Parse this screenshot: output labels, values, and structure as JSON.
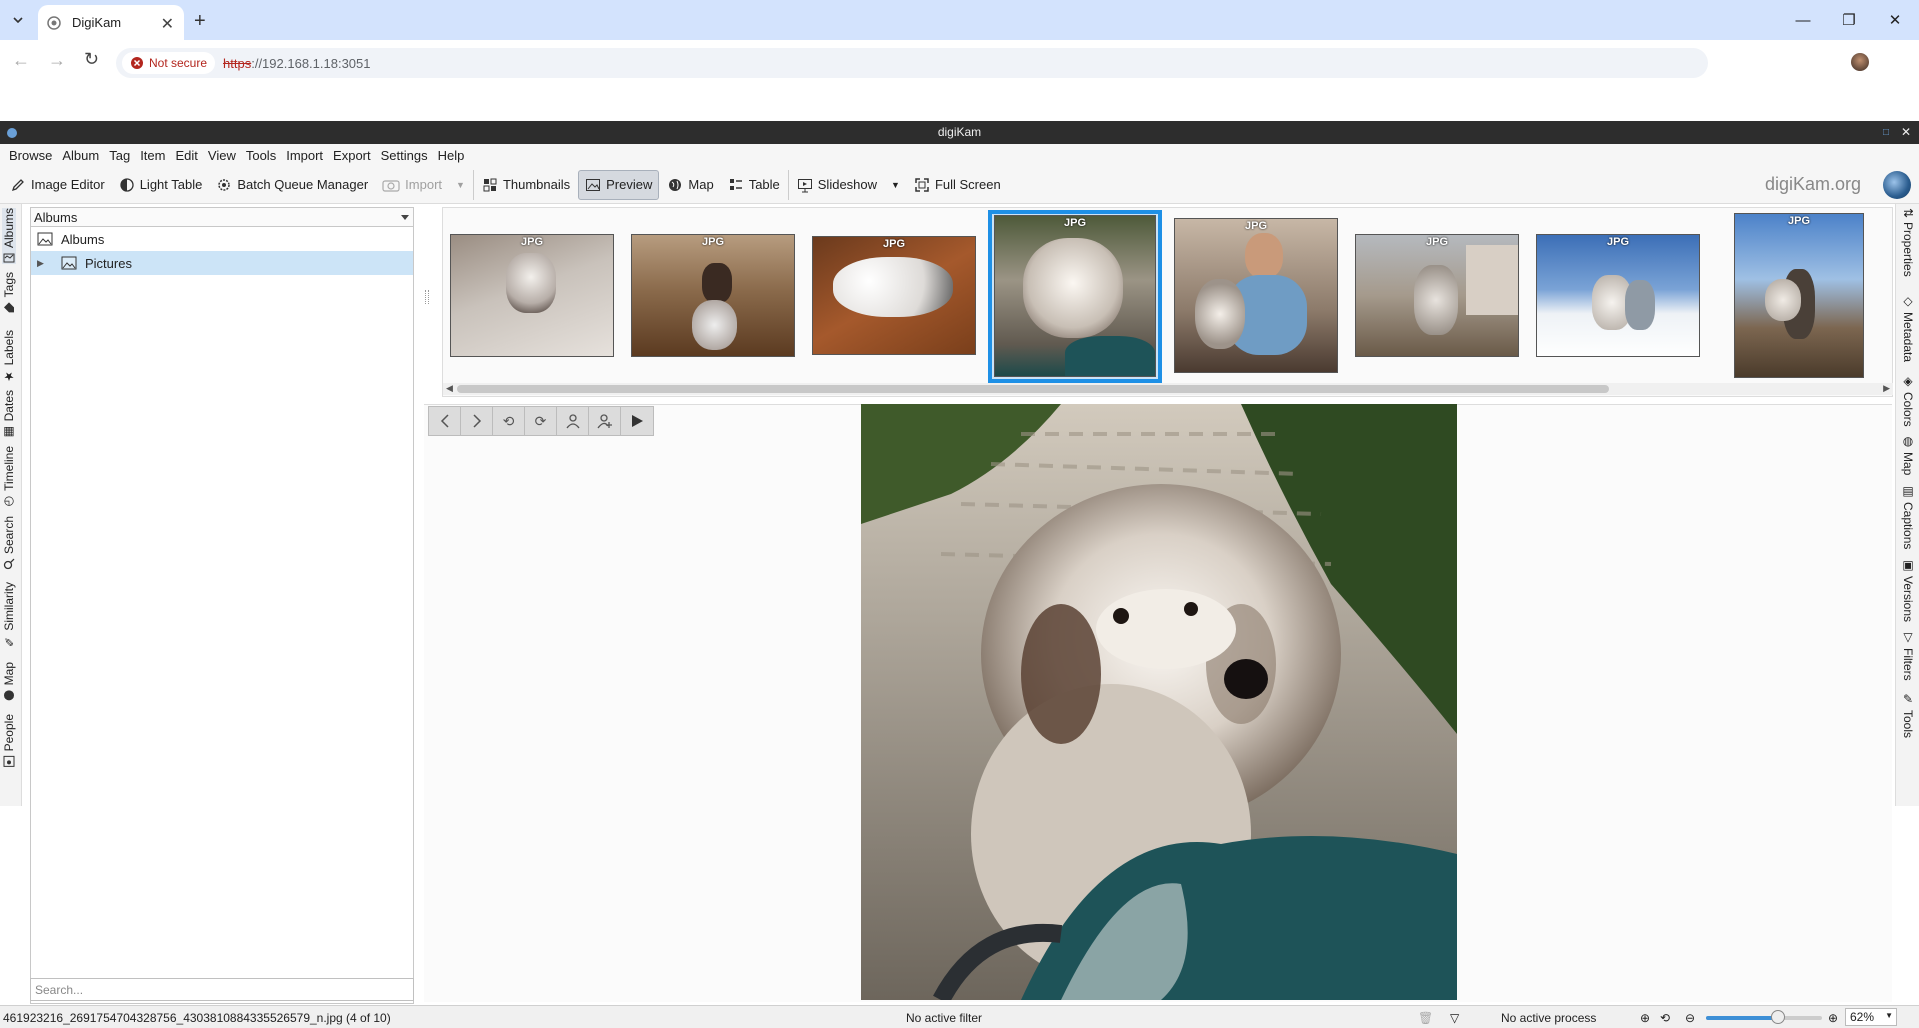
{
  "browser": {
    "tab_title": "DigiKam",
    "security_label": "Not secure",
    "url_scheme": "https",
    "url_rest": "://192.168.1.18:3051"
  },
  "app": {
    "window_title": "digiKam",
    "menus": [
      "Browse",
      "Album",
      "Tag",
      "Item",
      "Edit",
      "View",
      "Tools",
      "Import",
      "Export",
      "Settings",
      "Help"
    ],
    "toolbar": {
      "image_editor": "Image Editor",
      "light_table": "Light Table",
      "batch_queue": "Batch Queue Manager",
      "import": "Import",
      "thumbnails": "Thumbnails",
      "preview": "Preview",
      "map": "Map",
      "table": "Table",
      "slideshow": "Slideshow",
      "full_screen": "Full Screen"
    },
    "brand": "digiKam.org"
  },
  "left_tabs": [
    "Albums",
    "Tags",
    "Labels",
    "Dates",
    "Timeline",
    "Search",
    "Similarity",
    "Map",
    "People"
  ],
  "right_tabs": [
    "Properties",
    "Metadata",
    "Colors",
    "Map",
    "Captions",
    "Versions",
    "Filters",
    "Tools"
  ],
  "left_panel": {
    "view_select": "Albums",
    "tree": [
      {
        "label": "Albums"
      },
      {
        "label": "Pictures"
      }
    ],
    "search_placeholder": "Search..."
  },
  "thumbnails": {
    "badge": "JPG",
    "count": 8,
    "selected_index": 3
  },
  "status": {
    "filename": "461923216_2691754704328756_4303810884335526579_n.jpg (4 of 10)",
    "filter": "No active filter",
    "process": "No active process",
    "zoom": "62%",
    "zoom_level": 0.62
  }
}
